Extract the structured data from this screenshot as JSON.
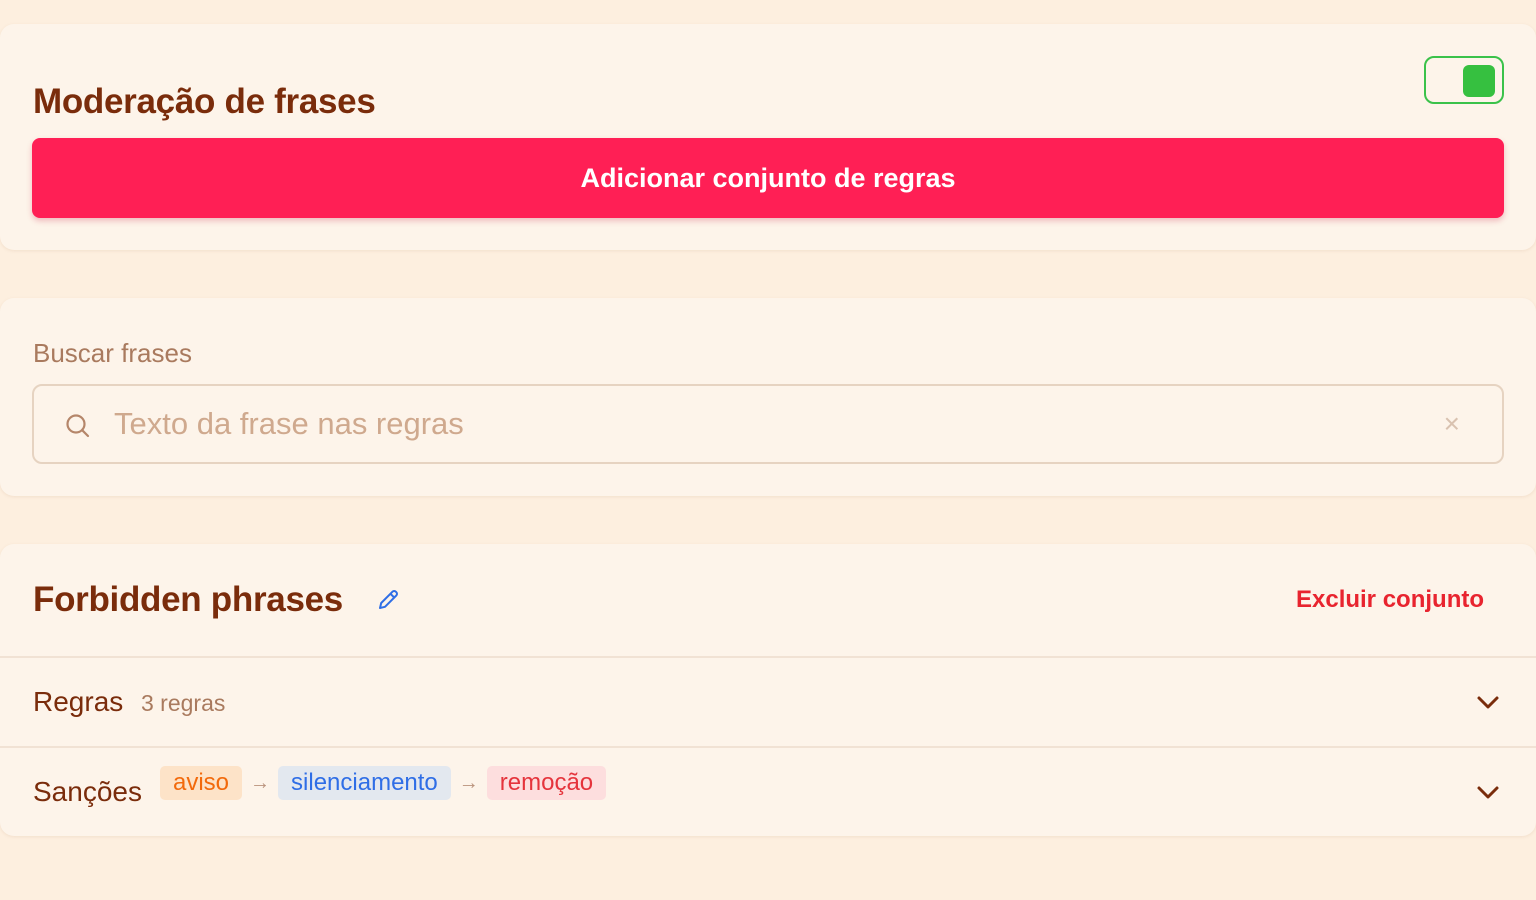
{
  "moderation": {
    "title": "Moderação de frases",
    "toggle_enabled": true,
    "toggle_color": "#36c040",
    "add_button_label": "Adicionar conjunto de regras",
    "accent": "#ff1f55"
  },
  "search": {
    "label": "Buscar frases",
    "placeholder": "Texto da frase nas regras",
    "value": "",
    "icon": "search-icon",
    "clear_icon": "close-icon",
    "clear_glyph": "×"
  },
  "ruleset": {
    "title": "Forbidden phrases",
    "edit_icon": "pencil-icon",
    "delete_label": "Excluir conjunto",
    "rules": {
      "label": "Regras",
      "count_label": "3 regras"
    },
    "sanctions": {
      "label": "Sanções",
      "steps": [
        "aviso",
        "silenciamento",
        "remoção"
      ],
      "arrow": "→"
    }
  }
}
